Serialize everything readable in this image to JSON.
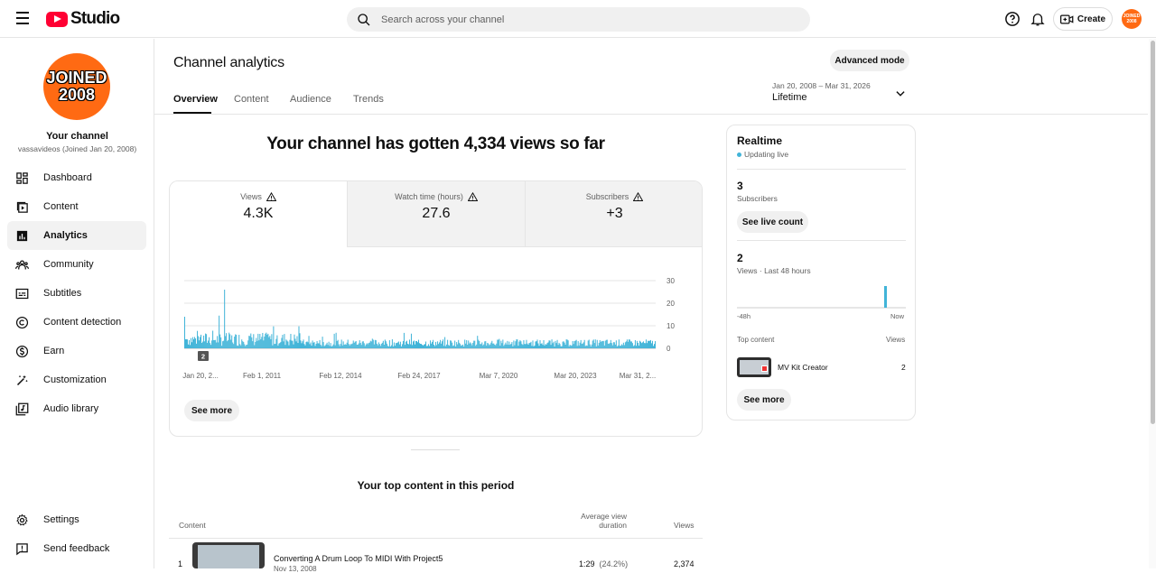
{
  "header": {
    "logo_text": "Studio",
    "search_placeholder": "Search across your channel",
    "create_label": "Create",
    "avatar_line1": "JOINED",
    "avatar_line2": "2008"
  },
  "sidebar": {
    "avatar_line1": "JOINED",
    "avatar_line2": "2008",
    "channel_title": "Your channel",
    "channel_sub": "vassavideos (Joined Jan 20, 2008)",
    "items": [
      {
        "label": "Dashboard",
        "icon": "dashboard-icon"
      },
      {
        "label": "Content",
        "icon": "content-icon"
      },
      {
        "label": "Analytics",
        "icon": "analytics-icon",
        "active": true
      },
      {
        "label": "Community",
        "icon": "community-icon"
      },
      {
        "label": "Subtitles",
        "icon": "subtitles-icon"
      },
      {
        "label": "Content detection",
        "icon": "copyright-icon"
      },
      {
        "label": "Earn",
        "icon": "dollar-icon"
      },
      {
        "label": "Customization",
        "icon": "magic-wand-icon"
      },
      {
        "label": "Audio library",
        "icon": "audio-library-icon"
      }
    ],
    "bottom_items": [
      {
        "label": "Settings",
        "icon": "gear-icon"
      },
      {
        "label": "Send feedback",
        "icon": "feedback-icon"
      }
    ]
  },
  "main": {
    "title": "Channel analytics",
    "advanced_mode": "Advanced mode",
    "tabs": [
      "Overview",
      "Content",
      "Audience",
      "Trends"
    ],
    "active_tab": "Overview",
    "date_range": "Jan 20, 2008 – Mar 31, 2026",
    "date_label": "Lifetime",
    "headline": "Your channel has gotten 4,334 views so far",
    "metrics": [
      {
        "label": "Views",
        "value": "4.3K"
      },
      {
        "label": "Watch time (hours)",
        "value": "27.6"
      },
      {
        "label": "Subscribers",
        "value": "+3"
      }
    ],
    "see_more": "See more",
    "top_content_title": "Your top content in this period",
    "columns": {
      "content": "Content",
      "avg_line1": "Average view",
      "avg_line2": "duration",
      "views": "Views"
    },
    "rows": [
      {
        "index": "1",
        "title": "Converting A Drum Loop To MIDI With Project5",
        "date": "Nov 13, 2008",
        "duration": "1:29",
        "percent": "(24.2%)",
        "views": "2,374"
      }
    ]
  },
  "chart_data": {
    "type": "bar",
    "x_tick_labels": [
      "Jan 20, 2...",
      "Feb 1, 2011",
      "Feb 12, 2014",
      "Feb 24, 2017",
      "Mar 7, 2020",
      "Mar 20, 2023",
      "Mar 31, 2..."
    ],
    "y_tick_labels": [
      "30",
      "20",
      "10",
      "0"
    ],
    "ylim": [
      0,
      30
    ],
    "marker_label": "2",
    "color": "#41b4d8",
    "grid": true,
    "description_values": {
      "peak": 26,
      "early_peaks": [
        14,
        26,
        16,
        9,
        11
      ],
      "typical_daily": 3
    }
  },
  "realtime": {
    "title": "Realtime",
    "live": "Updating live",
    "subs_value": "3",
    "subs_label": "Subscribers",
    "live_count_btn": "See live count",
    "views_value": "2",
    "views_label": "Views · Last 48 hours",
    "axis_left": "-48h",
    "axis_right": "Now",
    "top_content": "Top content",
    "views_col": "Views",
    "item_title": "MV Kit Creator",
    "item_views": "2",
    "see_more": "See more",
    "accent": "#41b4d8"
  }
}
